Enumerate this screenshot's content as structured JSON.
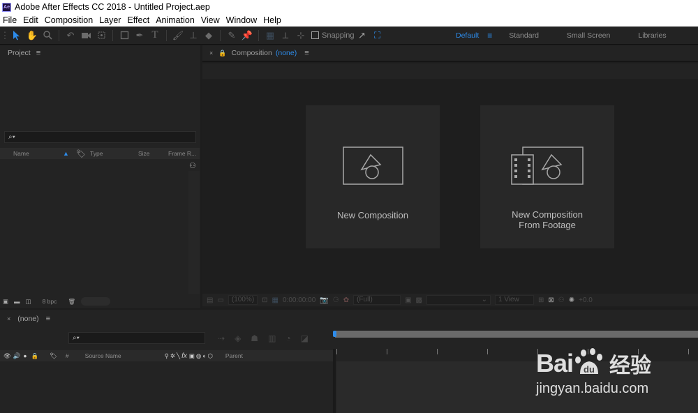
{
  "window": {
    "title": "Adobe After Effects CC 2018 - Untitled Project.aep",
    "app_icon": "Ae"
  },
  "menu": [
    "File",
    "Edit",
    "Composition",
    "Layer",
    "Effect",
    "Animation",
    "View",
    "Window",
    "Help"
  ],
  "toolbar": {
    "snapping_label": "Snapping",
    "tools": [
      "selection-tool-icon",
      "hand-tool-icon",
      "zoom-tool-icon",
      "rotate-tool-icon",
      "camera-tool-icon",
      "pan-behind-tool-icon",
      "rectangle-tool-icon",
      "pen-tool-icon",
      "type-tool-icon",
      "brush-tool-icon",
      "clone-stamp-tool-icon",
      "eraser-tool-icon",
      "roto-brush-tool-icon",
      "puppet-pin-tool-icon"
    ]
  },
  "workspaces": {
    "items": [
      "Default",
      "Standard",
      "Small Screen",
      "Libraries"
    ],
    "active": "Default"
  },
  "project_panel": {
    "title": "Project",
    "search_placeholder": "⌕▾",
    "columns": {
      "name": "Name",
      "type": "Type",
      "size": "Size",
      "frame_rate": "Frame R..."
    },
    "bit_depth": "8 bpc"
  },
  "composition_panel": {
    "tab_label": "Composition",
    "tab_value": "(none)",
    "cards": {
      "new_comp": "New Composition",
      "new_comp_footage_line1": "New Composition",
      "new_comp_footage_line2": "From Footage"
    },
    "viewer": {
      "zoom": "(100%)",
      "timecode": "0:00:00:00",
      "resolution": "(Full)",
      "view": "1 View",
      "exposure": "+0.0"
    }
  },
  "timeline_panel": {
    "tab_label": "(none)",
    "search_placeholder": "⌕▾",
    "columns": {
      "number": "#",
      "source_name": "Source Name",
      "parent": "Parent",
      "fx": "fx"
    }
  },
  "watermark": {
    "brand": "Bai",
    "brand_cn": "经验",
    "url": "jingyan.baidu.com"
  },
  "colors": {
    "accent": "#2d8ceb",
    "panel": "#232323",
    "background": "#1d1d1d"
  }
}
